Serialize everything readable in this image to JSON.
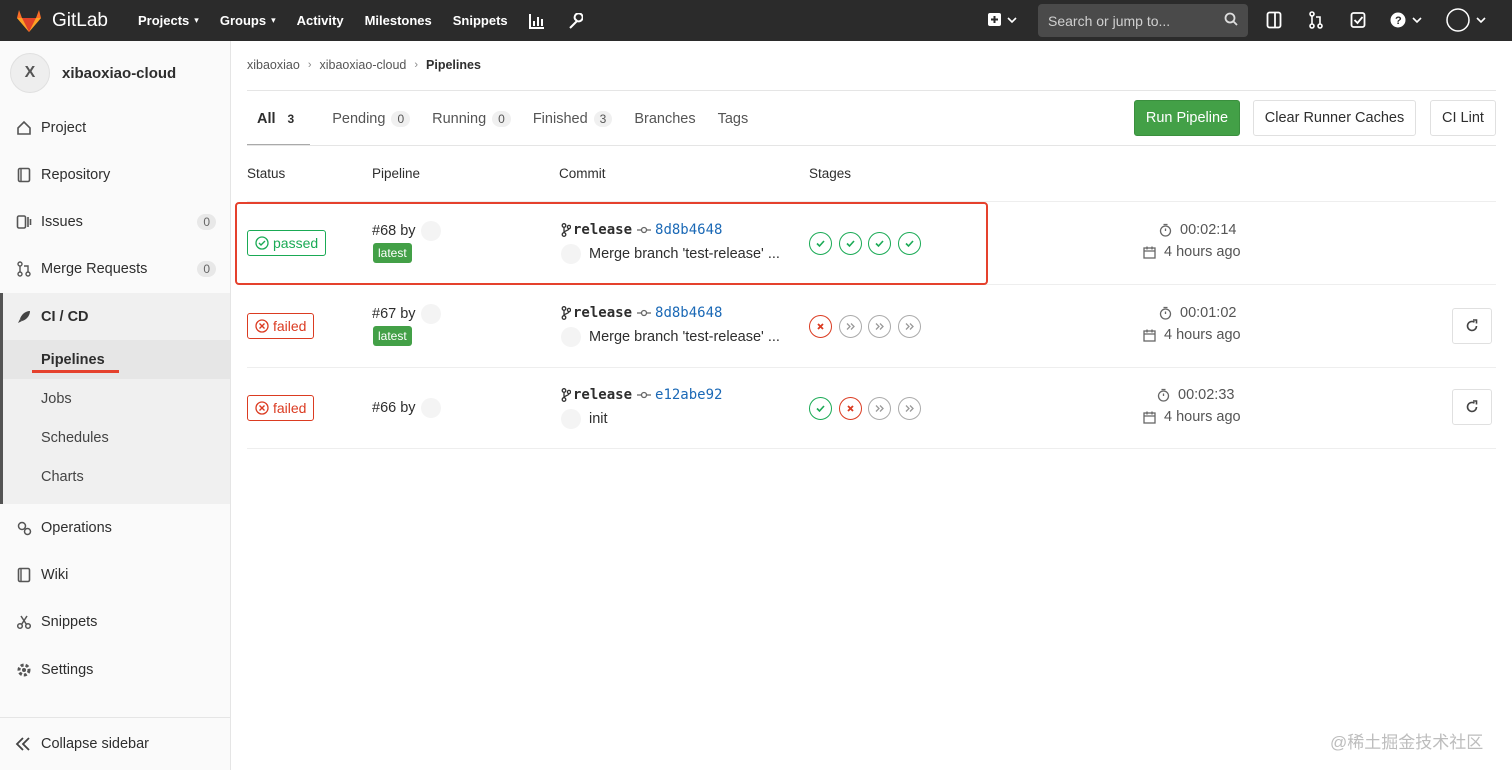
{
  "navbar": {
    "brand": "GitLab",
    "links": [
      {
        "label": "Projects",
        "caret": true
      },
      {
        "label": "Groups",
        "caret": true
      },
      {
        "label": "Activity",
        "caret": false
      },
      {
        "label": "Milestones",
        "caret": false
      },
      {
        "label": "Snippets",
        "caret": false
      }
    ],
    "search_placeholder": "Search or jump to..."
  },
  "sidebar": {
    "project_initial": "X",
    "project_name": "xibaoxiao-cloud",
    "items": [
      {
        "label": "Project",
        "icon": "home-icon"
      },
      {
        "label": "Repository",
        "icon": "book-icon"
      },
      {
        "label": "Issues",
        "icon": "issues-icon",
        "count": "0"
      },
      {
        "label": "Merge Requests",
        "icon": "merge-request-icon",
        "count": "0"
      },
      {
        "label": "CI / CD",
        "icon": "rocket-icon"
      }
    ],
    "cicd_sub": [
      "Pipelines",
      "Jobs",
      "Schedules",
      "Charts"
    ],
    "bottom_items": [
      {
        "label": "Operations",
        "icon": "cloud-gear-icon"
      },
      {
        "label": "Wiki",
        "icon": "wiki-book-icon"
      },
      {
        "label": "Snippets",
        "icon": "scissors-icon"
      },
      {
        "label": "Settings",
        "icon": "gear-icon"
      }
    ],
    "collapse_label": "Collapse sidebar"
  },
  "breadcrumb": [
    "xibaoxiao",
    "xibaoxiao-cloud",
    "Pipelines"
  ],
  "tabs": [
    {
      "label": "All",
      "count": "3"
    },
    {
      "label": "Pending",
      "count": "0"
    },
    {
      "label": "Running",
      "count": "0"
    },
    {
      "label": "Finished",
      "count": "3"
    },
    {
      "label": "Branches"
    },
    {
      "label": "Tags"
    }
  ],
  "actions": {
    "run_pipeline": "Run Pipeline",
    "clear_caches": "Clear Runner Caches",
    "ci_lint": "CI Lint"
  },
  "table": {
    "headers": [
      "Status",
      "Pipeline",
      "Commit",
      "Stages"
    ],
    "rows": [
      {
        "status": "passed",
        "id": "#68 by",
        "latest": "latest",
        "branch": "release",
        "sha": "8d8b4648",
        "message": "Merge branch 'test-release' ...",
        "stages": [
          "success",
          "success",
          "success",
          "success"
        ],
        "duration": "00:02:14",
        "finished": "4 hours ago"
      },
      {
        "status": "failed",
        "id": "#67 by",
        "latest": "latest",
        "branch": "release",
        "sha": "8d8b4648",
        "message": "Merge branch 'test-release' ...",
        "stages": [
          "failed",
          "skipped",
          "skipped",
          "skipped"
        ],
        "duration": "00:01:02",
        "finished": "4 hours ago"
      },
      {
        "status": "failed",
        "id": "#66 by",
        "latest": "",
        "branch": "release",
        "sha": "e12abe92",
        "message": "init",
        "stages": [
          "success",
          "failed",
          "skipped",
          "skipped"
        ],
        "duration": "00:02:33",
        "finished": "4 hours ago"
      }
    ]
  },
  "colors": {
    "navbar_bg": "#2b2b2b",
    "success": "#1aaa55",
    "failed": "#db3b21",
    "primary_button": "#43a047",
    "highlight": "#e5412d"
  },
  "watermark": "@稀土掘金技术社区"
}
